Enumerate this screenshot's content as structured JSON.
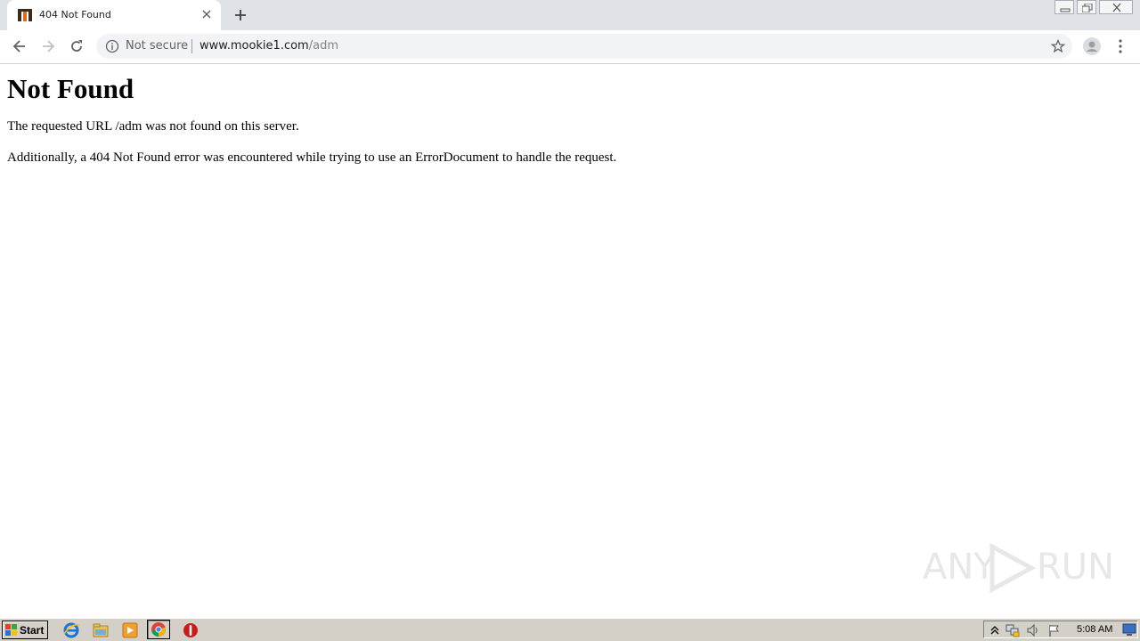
{
  "browser": {
    "tab": {
      "title": "404 Not Found",
      "favicon": "mookie-favicon-icon"
    },
    "address": {
      "security_label": "Not secure",
      "url_host": "www.mookie1.com",
      "url_path": "/adm"
    }
  },
  "page": {
    "heading": "Not Found",
    "paragraphs": [
      "The requested URL /adm was not found on this server.",
      "Additionally, a 404 Not Found error was encountered while trying to use an ErrorDocument to handle the request."
    ]
  },
  "watermark": {
    "text_left": "ANY",
    "text_right": "RUN"
  },
  "taskbar": {
    "start_label": "Start",
    "clock": "5:08 AM",
    "apps": [
      "internet-explorer-icon",
      "file-explorer-icon",
      "media-player-icon",
      "chrome-icon",
      "stop-icon"
    ]
  }
}
